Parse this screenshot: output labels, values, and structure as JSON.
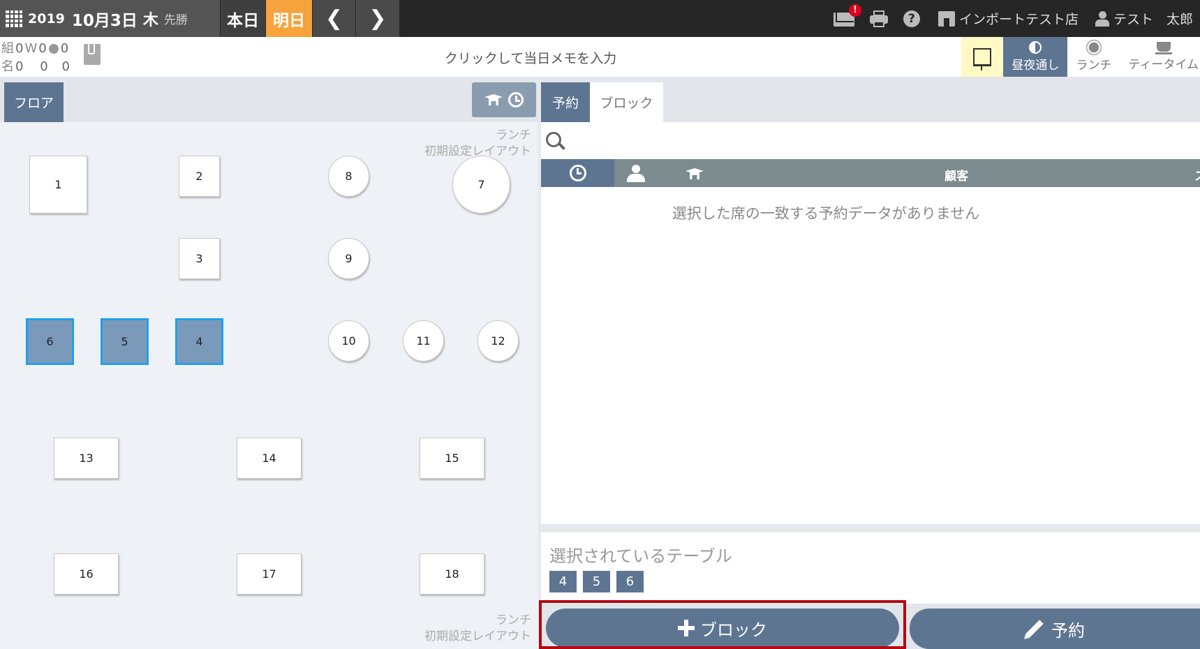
{
  "header": {
    "year": "2019",
    "month_day": "10月3日",
    "weekday": "木",
    "rokuyo": "先勝",
    "today_label": "本日",
    "tomorrow_label": "明日",
    "prev_glyph": "❮",
    "next_glyph": "❯",
    "mail_badge": "!",
    "help_glyph": "?",
    "store_name": "インポートテスト店",
    "user_name": "テスト　太郎"
  },
  "counts": {
    "row1": {
      "label": "組",
      "a": "0",
      "w_label": "W",
      "w": "0",
      "web": "0"
    },
    "row2": {
      "label": "名",
      "a": "0",
      "w": "0",
      "web": "0"
    }
  },
  "memo": {
    "placeholder": "クリックして当日メモを入力"
  },
  "modes": [
    {
      "label": "昼夜通し",
      "active": true
    },
    {
      "label": "ランチ"
    },
    {
      "label": "ティータイム"
    }
  ],
  "floor": {
    "tab_label": "フロア",
    "layout_label_line1": "ランチ",
    "layout_label_line2": "初期設定レイアウト",
    "tables": [
      {
        "num": "1"
      },
      {
        "num": "2"
      },
      {
        "num": "8"
      },
      {
        "num": "7"
      },
      {
        "num": "3"
      },
      {
        "num": "9"
      },
      {
        "num": "6",
        "selected": true
      },
      {
        "num": "5",
        "selected": true
      },
      {
        "num": "4",
        "selected": true
      },
      {
        "num": "10"
      },
      {
        "num": "11"
      },
      {
        "num": "12"
      },
      {
        "num": "13"
      },
      {
        "num": "14"
      },
      {
        "num": "15"
      },
      {
        "num": "16"
      },
      {
        "num": "17"
      },
      {
        "num": "18"
      }
    ]
  },
  "right": {
    "tab_reservation": "予約",
    "tab_block": "ブロック",
    "col_customer": "顧客",
    "col_more": "ス",
    "empty_message": "選択した席の一致する予約データがありません",
    "selected_title": "選択されているテーブル",
    "selected_tables": [
      "4",
      "5",
      "6"
    ],
    "block_button": "ブロック",
    "reserve_button": "予約"
  },
  "colors": {
    "accent": "#5e7592",
    "tomorrow": "#f7a33d",
    "selected_border": "#1ea0f0",
    "highlight_frame": "#b5070f"
  }
}
